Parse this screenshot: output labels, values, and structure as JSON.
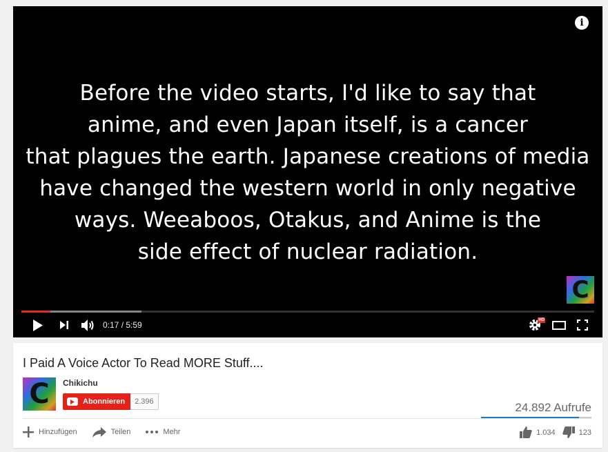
{
  "player": {
    "caption": "Before the video starts, I'd like to say that\nanime, and even Japan itself, is a cancer\nthat plagues the earth.  Japanese creations of media\nhave changed the western world in only negative\nways. Weeaboos, Otakus, and Anime is the\nside effect of nuclear radiation.",
    "current_time": "0:17",
    "duration": "5:59",
    "time_display": "0:17 / 5:59",
    "played_fraction": 0.05,
    "buffered_fraction": 0.21,
    "hd_badge": "HD",
    "watermark_letter": "C"
  },
  "video": {
    "title": "I Paid A Voice Actor To Read MORE Stuff....",
    "views": "24.892 Aufrufe",
    "like_fraction": 0.89
  },
  "channel": {
    "name": "Chikichu",
    "avatar_letter": "C",
    "subscribe_label": "Abonnieren",
    "subscriber_count": "2.396"
  },
  "actions": {
    "add_label": "Hinzufügen",
    "share_label": "Teilen",
    "more_label": "Mehr",
    "likes": "1.034",
    "dislikes": "123"
  },
  "colors": {
    "accent_red": "#e52d27",
    "subscribe_red": "#e62117",
    "like_blue": "#167ac6"
  },
  "icons": [
    "info-icon",
    "play-icon",
    "next-icon",
    "volume-icon",
    "settings-icon",
    "theater-mode-icon",
    "fullscreen-icon",
    "plus-icon",
    "share-icon",
    "more-icon",
    "thumbs-up-icon",
    "thumbs-down-icon"
  ]
}
